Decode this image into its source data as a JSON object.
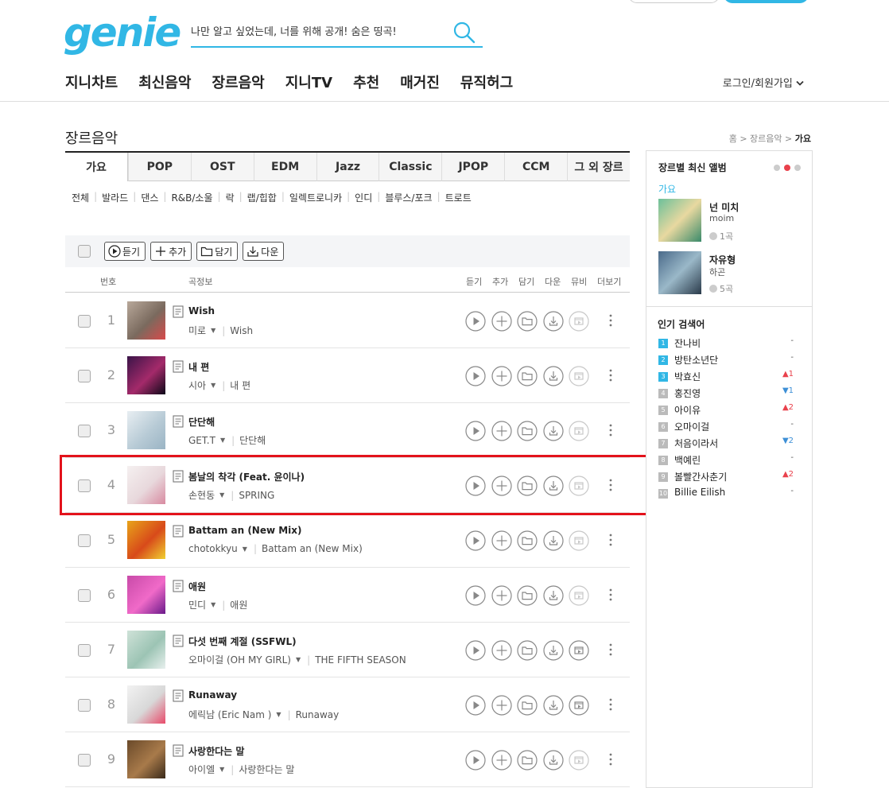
{
  "header": {
    "logo": "genie",
    "search_placeholder": "나만 알고 싶었는데, 너를 위해 공개! 숨은 띵곡!",
    "nav": [
      "지니차트",
      "최신음악",
      "장르음악",
      "지니TV",
      "추천",
      "매거진",
      "뮤직허그"
    ],
    "login": "로그인/회원가입"
  },
  "page": {
    "title": "장르음악",
    "breadcrumb": [
      "홈",
      "장르음악",
      "가요"
    ]
  },
  "tabs": [
    "가요",
    "POP",
    "OST",
    "EDM",
    "Jazz",
    "Classic",
    "JPOP",
    "CCM",
    "그 외 장르"
  ],
  "subgenres": [
    "전체",
    "발라드",
    "댄스",
    "R&B/소울",
    "락",
    "랩/힙합",
    "일렉트로니카",
    "인디",
    "블루스/포크",
    "트로트"
  ],
  "toolbar": {
    "play": "듣기",
    "add": "추가",
    "save": "담기",
    "download": "다운"
  },
  "table_header": {
    "num": "번호",
    "info": "곡정보",
    "play": "듣기",
    "add": "추가",
    "save": "담기",
    "down": "다운",
    "mv": "뮤비",
    "more": "더보기"
  },
  "songs": [
    {
      "num": "1",
      "title": "Wish",
      "artist": "미로",
      "album": "Wish",
      "colors": [
        "#b8a89a",
        "#7a6a5e",
        "#d84a4a"
      ]
    },
    {
      "num": "2",
      "title": "내 편",
      "artist": "시아",
      "album": "내 편",
      "colors": [
        "#3a1448",
        "#a42a6a",
        "#0c0818"
      ]
    },
    {
      "num": "3",
      "title": "단단해",
      "artist": "GET.T",
      "album": "단단해",
      "colors": [
        "#e8eef2",
        "#b8cbd6",
        "#9ab4c4"
      ]
    },
    {
      "num": "4",
      "title": "봄날의 착각 (Feat. 윤이나)",
      "artist": "손현동",
      "album": "SPRING",
      "colors": [
        "#f5f0f0",
        "#e8d8dc",
        "#d88aa0"
      ]
    },
    {
      "num": "5",
      "title": "Battam an (New Mix)",
      "artist": "chotokkyu",
      "album": "Battam an (New Mix)",
      "colors": [
        "#e8a41a",
        "#d84a1a",
        "#f0d030"
      ]
    },
    {
      "num": "6",
      "title": "애원",
      "artist": "민디",
      "album": "애원",
      "colors": [
        "#c84aa8",
        "#f06ac8",
        "#6a1a8a"
      ]
    },
    {
      "num": "7",
      "title": "다섯 번째 계절 (SSFWL)",
      "artist": "오마이걸 (OH MY GIRL)",
      "album": "THE FIFTH SEASON",
      "colors": [
        "#cfe2d8",
        "#9cc4b4",
        "#e8f0ee"
      ]
    },
    {
      "num": "8",
      "title": "Runaway",
      "artist": "에릭남 (Eric Nam )",
      "album": "Runaway",
      "colors": [
        "#f2f2f2",
        "#d8d8d8",
        "#e84a6a"
      ]
    },
    {
      "num": "9",
      "title": "사랑한다는 말",
      "artist": "아이엘",
      "album": "사랑한다는 말",
      "colors": [
        "#6a4a2a",
        "#a87a4a",
        "#3a2a1a"
      ]
    }
  ],
  "sidebar": {
    "latest_title": "장르별 최신 앨범",
    "genre": "가요",
    "albums": [
      {
        "title": "넌 미치",
        "artist": "moim",
        "count": "1곡",
        "colors": [
          "#6cc09a",
          "#e8d8a0",
          "#3a8a6a"
        ]
      },
      {
        "title": "자유형",
        "artist": "하곤",
        "count": "5곡",
        "colors": [
          "#4a6a8a",
          "#9ab8c8",
          "#2a3a4a"
        ]
      }
    ],
    "keywords_title": "인기 검색어",
    "keywords": [
      {
        "rank": "1",
        "text": "잔나비",
        "change": "-",
        "dir": "same"
      },
      {
        "rank": "2",
        "text": "방탄소년단",
        "change": "-",
        "dir": "same"
      },
      {
        "rank": "3",
        "text": "박효신",
        "change": "▲1",
        "dir": "up"
      },
      {
        "rank": "4",
        "text": "홍진영",
        "change": "▼1",
        "dir": "down"
      },
      {
        "rank": "5",
        "text": "아이유",
        "change": "▲2",
        "dir": "up"
      },
      {
        "rank": "6",
        "text": "오마이걸",
        "change": "-",
        "dir": "same"
      },
      {
        "rank": "7",
        "text": "처음이라서",
        "change": "▼2",
        "dir": "down"
      },
      {
        "rank": "8",
        "text": "백예린",
        "change": "-",
        "dir": "same"
      },
      {
        "rank": "9",
        "text": "볼빨간사춘기",
        "change": "▲2",
        "dir": "up"
      },
      {
        "rank": "10",
        "text": "Billie Eilish",
        "change": "-",
        "dir": "same"
      }
    ],
    "rank_colors": {
      "top3": "#31b7e5",
      "rest": "#bbbbbb"
    }
  },
  "accent_color": "#31b7e5",
  "highlight_color": "#e3121b"
}
